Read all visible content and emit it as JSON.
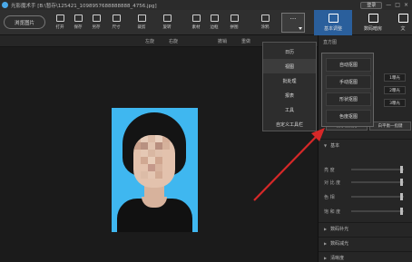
{
  "titlebar": {
    "title": "光影魔术手 [B:\\暂存\\125421_1098957688888888_4756.jpg]",
    "login": "登录",
    "controls": [
      "—",
      "□",
      "×"
    ]
  },
  "toolbar": {
    "open": "浏览图片",
    "tools": [
      {
        "label": "打开",
        "icon": "folder-icon"
      },
      {
        "label": "保存",
        "icon": "save-icon"
      },
      {
        "label": "另存",
        "icon": "save-as-icon"
      },
      {
        "label": "尺寸",
        "icon": "resize-icon"
      },
      {
        "label": "裁剪",
        "icon": "crop-icon"
      },
      {
        "label": "旋转",
        "icon": "rotate-icon"
      },
      {
        "label": "素材",
        "icon": "material-icon"
      },
      {
        "label": "边框",
        "icon": "frame-icon"
      },
      {
        "label": "拼图",
        "icon": "puzzle-icon"
      },
      {
        "label": "涂鸦",
        "icon": "brush-icon"
      }
    ],
    "more": "...",
    "modes": {
      "basic": "基本调整",
      "batch": "数码暗房",
      "extra": "文"
    }
  },
  "actionbar": {
    "rotate_left": "左旋",
    "rotate_right": "右旋",
    "undo": "撤销",
    "redo": "重做"
  },
  "view_menu": [
    "日历",
    "视图",
    "批处理",
    "报表",
    "工具",
    "自定义工具栏"
  ],
  "sub_menu": [
    "自动抠图",
    "手动抠图",
    "形状抠图",
    "色度抠图"
  ],
  "right_panel": {
    "histogram": "直方图",
    "fields": [
      "1曝光",
      "2曝光",
      "3曝光"
    ],
    "buttons": [
      "数字点测光",
      "白平衡一指键"
    ],
    "section_basic": "基本",
    "sliders": [
      {
        "label": "亮 度"
      },
      {
        "label": "对 比 度"
      },
      {
        "label": "色 相"
      },
      {
        "label": "饱 和 度"
      }
    ],
    "sections": [
      "数码补光",
      "数码减光",
      "清晰度"
    ]
  },
  "colors": {
    "accent": "#2a5f9c",
    "photo_bg": "#3fb7f0",
    "arrow": "#d62828"
  }
}
